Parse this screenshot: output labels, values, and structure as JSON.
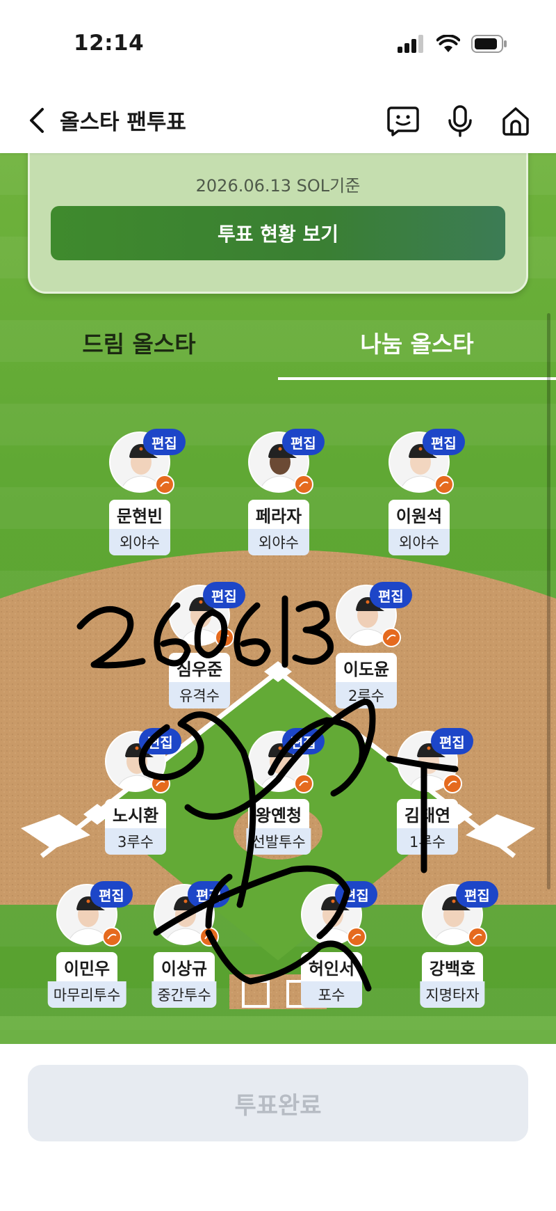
{
  "status_bar": {
    "time": "12:14"
  },
  "header": {
    "title": "올스타 팬투표"
  },
  "info_card": {
    "date_text": "2026.06.13 SOL기준",
    "button_label": "투표 현황 보기"
  },
  "tabs": [
    {
      "label": "드림 올스타",
      "selected": false
    },
    {
      "label": "나눔 올스타",
      "selected": true
    }
  ],
  "edit_label": "편집",
  "players": [
    {
      "name": "문현빈",
      "position": "외야수"
    },
    {
      "name": "페라자",
      "position": "외야수"
    },
    {
      "name": "이원석",
      "position": "외야수"
    },
    {
      "name": "심우준",
      "position": "유격수"
    },
    {
      "name": "이도윤",
      "position": "2루수"
    },
    {
      "name": "노시환",
      "position": "3루수"
    },
    {
      "name": "왕옌청",
      "position": "선발투수"
    },
    {
      "name": "김태연",
      "position": "1루수"
    },
    {
      "name": "이민우",
      "position": "마무리투수"
    },
    {
      "name": "이상규",
      "position": "중간투수"
    },
    {
      "name": "허인서",
      "position": "포수"
    },
    {
      "name": "강백호",
      "position": "지명타자"
    }
  ],
  "handwriting": {
    "date": "260613"
  },
  "footer": {
    "complete_label": "투표완료"
  },
  "colors": {
    "field_green": "#5ea733",
    "infield_dirt": "#c99a68",
    "edit_badge": "#1d46c8",
    "position_bg": "#dfe9f7"
  }
}
